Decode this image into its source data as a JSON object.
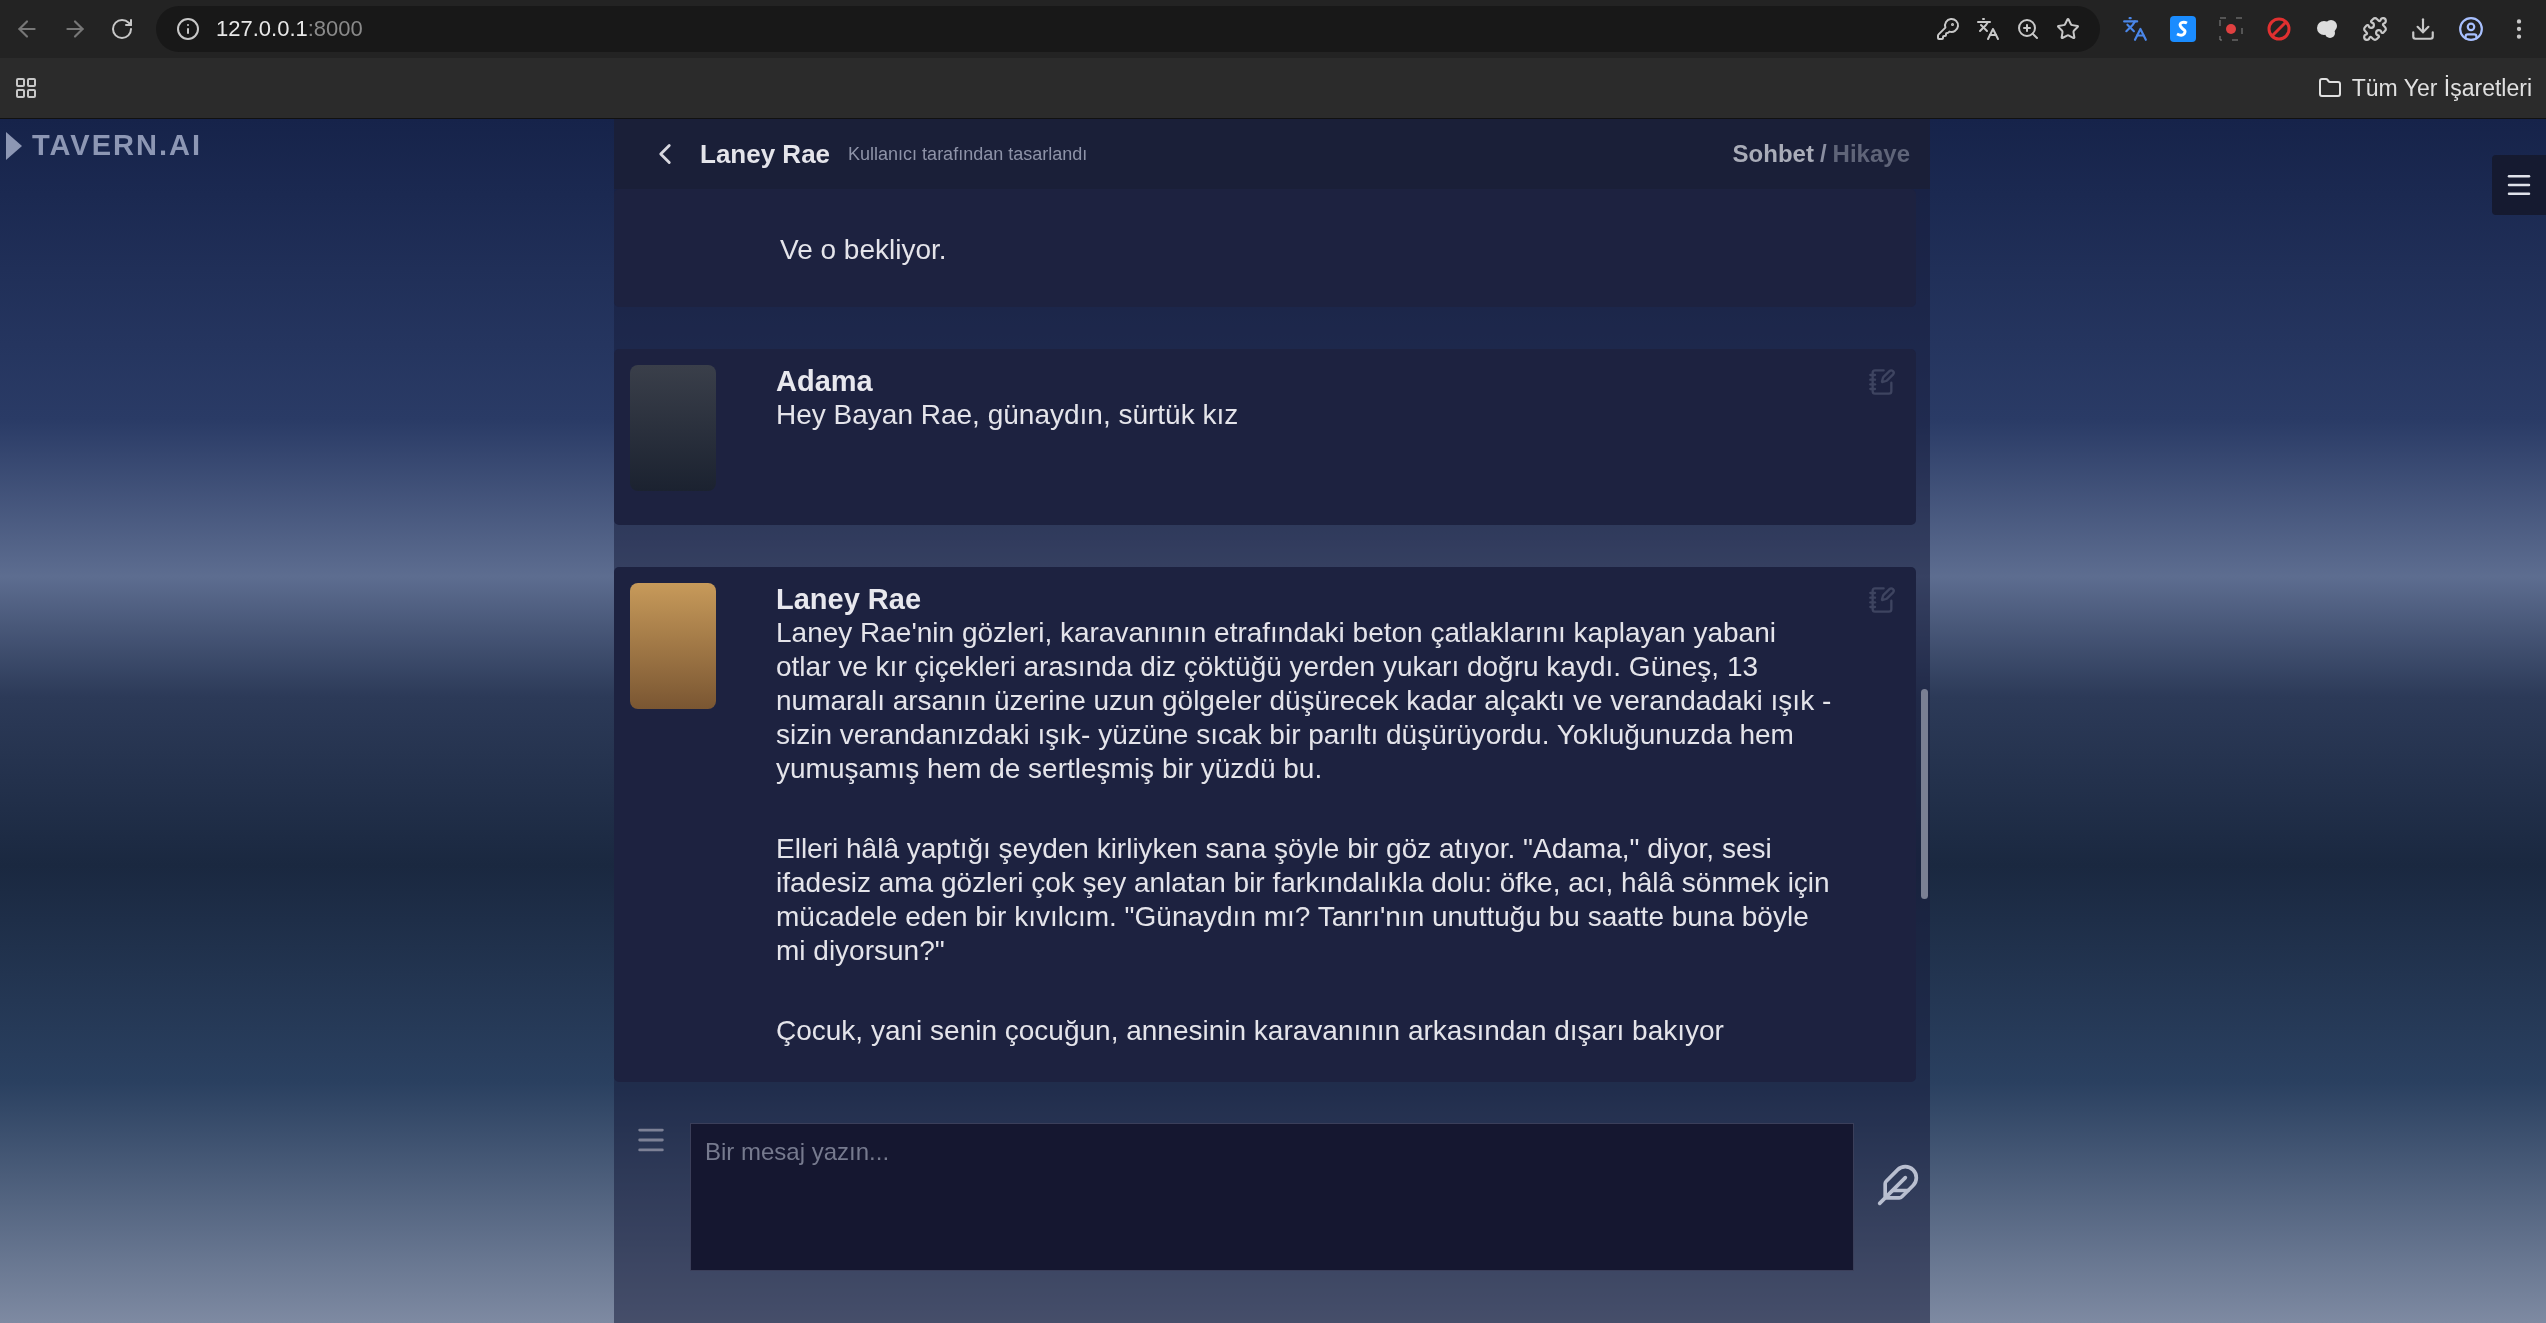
{
  "browser": {
    "url_host": "127.0.0.1",
    "url_port": ":8000",
    "bookmarks_label": "Tüm Yer İşaretleri"
  },
  "logo": {
    "text": "TAVERN.AI"
  },
  "chat_header": {
    "character_name": "Laney Rae",
    "subtitle": "Kullanıcı tarafından tasarlandı",
    "modes": [
      {
        "label": "Sohbet",
        "selected": true
      },
      {
        "label": "Hikaye",
        "selected": false
      }
    ],
    "separator": "/"
  },
  "messages": [
    {
      "kind": "continued",
      "paragraphs": [
        "Ve o bekliyor."
      ]
    },
    {
      "kind": "full",
      "name": "Adama",
      "paragraphs": [
        "Hey Bayan Rae, günaydın, sürtük kız"
      ]
    },
    {
      "kind": "full",
      "name": "Laney Rae",
      "paragraphs": [
        "Laney Rae'nin gözleri, karavanının etrafındaki beton çatlaklarını kaplayan yabani otlar ve kır çiçekleri arasında diz çöktüğü yerden yukarı doğru kaydı. Güneş, 13 numaralı arsanın üzerine uzun gölgeler düşürecek kadar alçaktı ve verandadaki ışık -sizin verandanızdaki ışık- yüzüne sıcak bir parıltı düşürüyordu. Yokluğunuzda hem yumuşamış hem de sertleşmiş bir yüzdü bu.",
        "Elleri hâlâ yaptığı şeyden kirliyken sana şöyle bir göz atıyor. \"Adama,\" diyor, sesi ifadesiz ama gözleri çok şey anlatan bir farkındalıkla dolu: öfke, acı, hâlâ sönmek için mücadele eden bir kıvılcım. \"Günaydın mı? Tanrı'nın unuttuğu bu saatte buna böyle mi diyorsun?\"",
        "Çocuk, yani senin çocuğun, annesinin karavanının arkasından dışarı bakıyor"
      ]
    }
  ],
  "composer": {
    "placeholder": "Bir mesaj yazın..."
  }
}
